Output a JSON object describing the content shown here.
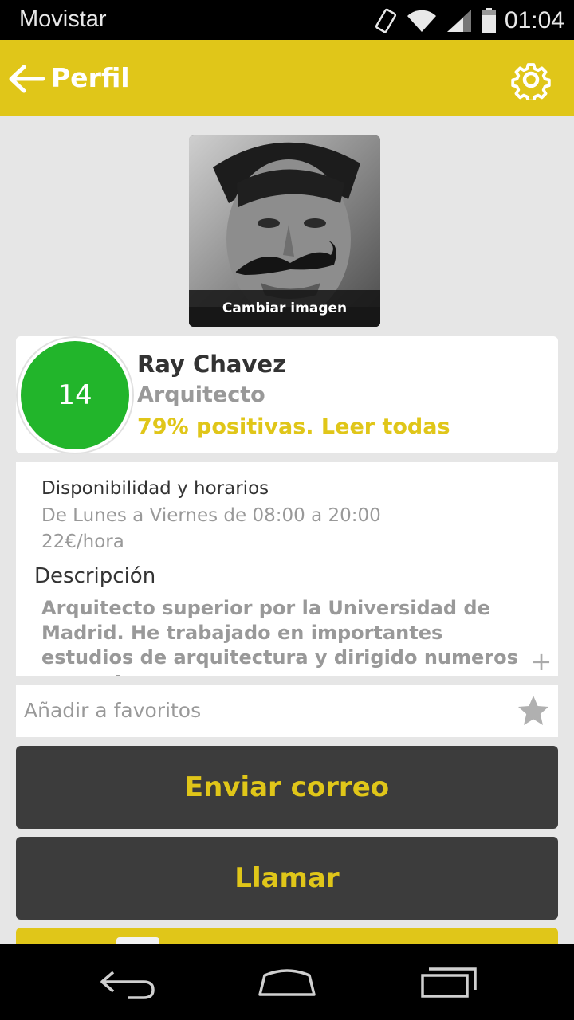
{
  "status_bar": {
    "carrier": "Movistar",
    "time": "01:04"
  },
  "app_bar": {
    "title": "Perfil",
    "back_icon": "arrow-left-icon",
    "settings_icon": "gear-icon"
  },
  "profile": {
    "photo_caption": "Cambiar imagen",
    "badge_value": "14",
    "name": "Ray Chavez",
    "profession": "Arquitecto",
    "ratings_link": "79% positivas. Leer todas"
  },
  "info": {
    "availability_title": "Disponibilidad y horarios",
    "availability_hours": "De Lunes a Viernes de 08:00 a 20:00",
    "rate": "22€/hora",
    "description_title": "Descripción",
    "description_text": "Arquitecto superior por la Universidad de Madrid. He trabajado en importantes estudios de arquitectura y dirigido numeros proyectos.",
    "expand_icon": "+"
  },
  "favorites": {
    "label": "Añadir a favoritos",
    "icon": "star-icon"
  },
  "actions": {
    "email_label": "Enviar correo",
    "call_label": "Llamar"
  },
  "colors": {
    "accent": "#e0c619",
    "badge": "#22b52b",
    "button_bg": "#3c3c3c",
    "page_bg": "#e6e6e6"
  }
}
